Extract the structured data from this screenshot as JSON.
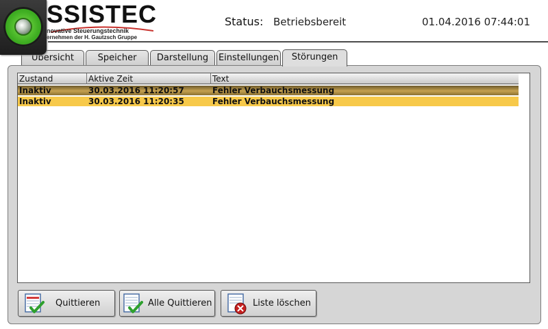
{
  "brand": {
    "name": "SSISTEC",
    "subtitle_line1": "novative Steuerungstechnik",
    "subtitle_line2": "ernehmen der H. Gautzsch Gruppe"
  },
  "header": {
    "status_label": "Status:",
    "status_value": "Betriebsbereit",
    "datetime": "01.04.2016 07:44:01"
  },
  "tabs": [
    {
      "label": "Übersicht",
      "active": false
    },
    {
      "label": "Speicher",
      "active": false
    },
    {
      "label": "Darstellung",
      "active": false
    },
    {
      "label": "Einstellungen",
      "active": false
    },
    {
      "label": "Störungen",
      "active": true
    }
  ],
  "table": {
    "columns": [
      "Zustand",
      "Aktive Zeit",
      "Text"
    ],
    "rows": [
      {
        "state": "Inaktiv",
        "time": "30.03.2016 11:20:57",
        "text": "Fehler Verbauchsmessung"
      },
      {
        "state": "Inaktiv",
        "time": "30.03.2016 11:20:35",
        "text": "Fehler Verbauchsmessung"
      }
    ]
  },
  "buttons": {
    "acknowledge": "Quittieren",
    "acknowledge_all": "Alle Quittieren",
    "clear_list": "Liste löschen"
  },
  "colors": {
    "row_selected": "#b08c42",
    "row_alarm": "#f7c94a",
    "logo_green": "#3fae22"
  }
}
